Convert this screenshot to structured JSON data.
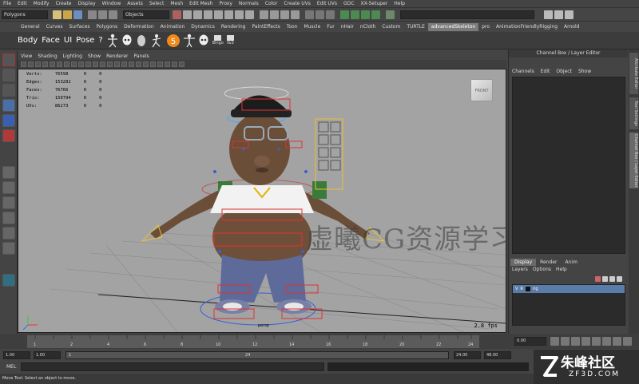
{
  "menubar": {
    "items": [
      "File",
      "Edit",
      "Modify",
      "Create",
      "Display",
      "Window",
      "Assets",
      "Select",
      "Mesh",
      "Edit Mesh",
      "Proxy",
      "Normals",
      "Color",
      "Create UVs",
      "Edit UVs",
      "GDC",
      "XX-Setuper",
      "Help"
    ]
  },
  "toolbar": {
    "mode_value": "Polygons",
    "selection_value": "Objects"
  },
  "shelf": {
    "tabs": [
      "General",
      "Curves",
      "Surfaces",
      "Polygons",
      "Deformation",
      "Animation",
      "Dynamics",
      "Rendering",
      "PaintEffects",
      "Toon",
      "Muscle",
      "Fur",
      "nHair",
      "nCloth",
      "Custom",
      "TURTLE",
      "advancedSkeleton",
      "pro",
      "AnimationFriendlyRigging",
      "Arnold"
    ],
    "active_tab": "advancedSkeleton",
    "buttons": [
      "Body",
      "Face",
      "UI",
      "Pose",
      "?"
    ],
    "small_labels": [
      "Bingo",
      "I&S"
    ]
  },
  "viewport": {
    "menu": [
      "View",
      "Shading",
      "Lighting",
      "Show",
      "Renderer",
      "Panels"
    ],
    "hud": [
      {
        "label": "Verts:",
        "v1": "76598",
        "v2": "0",
        "v3": "0"
      },
      {
        "label": "Edges:",
        "v1": "153281",
        "v2": "0",
        "v3": "0"
      },
      {
        "label": "Faces:",
        "v1": "76766",
        "v2": "0",
        "v3": "0"
      },
      {
        "label": "Tris:",
        "v1": "150794",
        "v2": "0",
        "v3": "0"
      },
      {
        "label": "UVs:",
        "v1": "86273",
        "v2": "0",
        "v3": "0"
      }
    ],
    "fps": "2.8 fps",
    "camera": "persp",
    "cube_label": "FRONT",
    "watermark": "虚曦CG资源学习店"
  },
  "channel_box": {
    "title": "Channel Box / Layer Editor",
    "menu": [
      "Channels",
      "Edit",
      "Object",
      "Show"
    ]
  },
  "layer_editor": {
    "tabs": [
      "Display",
      "Render",
      "Anim"
    ],
    "active_tab": "Display",
    "menu": [
      "Layers",
      "Options",
      "Help"
    ],
    "rows": [
      {
        "v": "V",
        "r": "R",
        "name": "rig"
      }
    ]
  },
  "side_tabs": [
    "Attribute Editor",
    "Tool Settings",
    "Channel Box / Layer Editor"
  ],
  "timeline": {
    "ticks": [
      "1",
      "2",
      "4",
      "6",
      "8",
      "10",
      "12",
      "14",
      "16",
      "18",
      "20",
      "22",
      "24"
    ],
    "current_frame": "0.00"
  },
  "range": {
    "start": "1.00",
    "start2": "1.00",
    "box": "1",
    "end_inner": "24",
    "end": "24.00",
    "end2": "48.00"
  },
  "command_line": {
    "label": "MEL"
  },
  "help_line": "Move Tool: Select an object to move.",
  "logo": {
    "main": "朱峰社区",
    "sub": "ZF3D.COM"
  }
}
